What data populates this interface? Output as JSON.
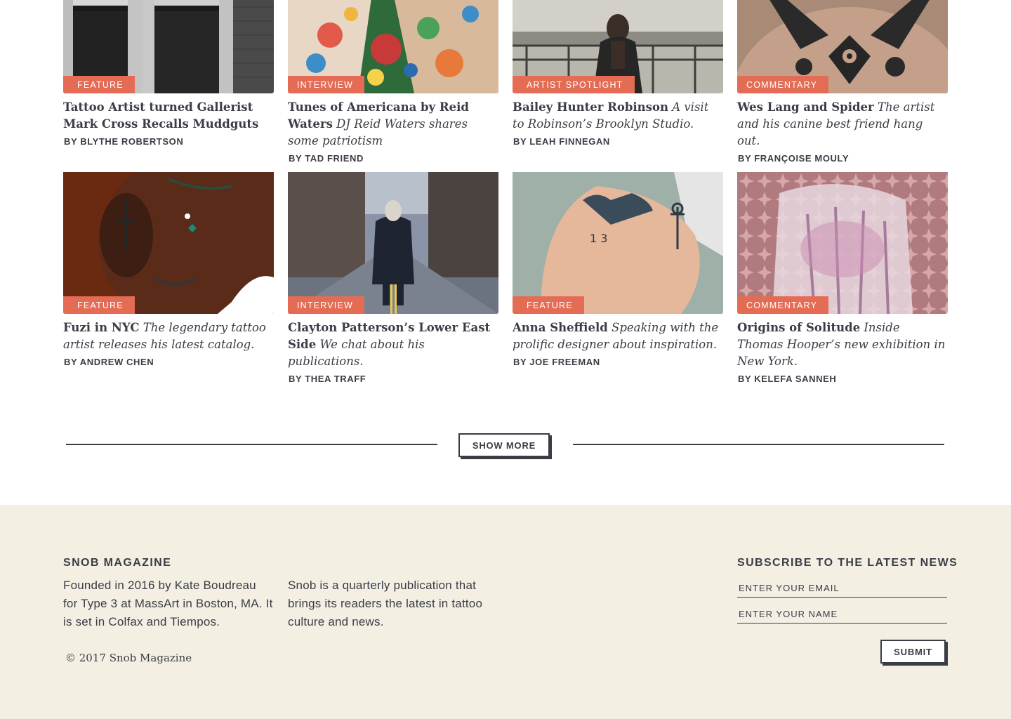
{
  "articles_row1": [
    {
      "category": "Feature",
      "title": "Tattoo Artist turned Gallerist Mark Cross Recalls Muddguts",
      "dek": "",
      "byline": "BY BLYTHE ROBERTSON"
    },
    {
      "category": "Interview",
      "title": "Tunes of Americana by Reid Waters",
      "dek": "DJ Reid Waters shares some patriotism",
      "byline": "BY TAD FRIEND"
    },
    {
      "category": "Artist Spotlight",
      "title": "Bailey Hunter Robinson",
      "dek": "A visit to Robinson’s Brooklyn Studio.",
      "byline": "BY LEAH FINNEGAN"
    },
    {
      "category": "Commentary",
      "title": "Wes Lang and Spider",
      "dek": "The artist and his canine best friend hang out.",
      "byline": "BY FRANÇOISE MOULY"
    }
  ],
  "articles_row2": [
    {
      "category": "Feature",
      "title": "Fuzi in NYC",
      "dek": "The legendary tattoo artist releases his latest catalog.",
      "byline": "BY ANDREW CHEN"
    },
    {
      "category": "Interview",
      "title": "Clayton Patterson’s Lower East Side",
      "dek": "We chat about his publications.",
      "byline": "BY THEA TRAFF"
    },
    {
      "category": "Feature",
      "title": "Anna Sheffield",
      "dek": "Speaking with the prolific designer about inspiration.",
      "byline": "BY JOE FREEMAN"
    },
    {
      "category": "Commentary",
      "title": "Origins of Solitude",
      "dek": " Inside Thomas Hooper’s new exhibition in New York.",
      "byline": "BY KELEFA SANNEH"
    }
  ],
  "show_more_label": "SHOW MORE",
  "footer": {
    "title": "SNOB MAGAZINE",
    "about_1": "Founded in 2016 by Kate Boudreau for Type 3 at MassArt in Boston, MA. It is set in Colfax and Tiempos.",
    "about_2": "Snob is a quarterly publication that brings its readers the latest in tattoo culture and news.",
    "copyright": "© 2017 Snob Magazine",
    "subscribe_title": "SUBSCRIBE TO THE LATEST NEWS",
    "email_placeholder": "ENTER YOUR EMAIL",
    "name_placeholder": "ENTER YOUR NAME",
    "submit_label": "SUBMIT"
  },
  "colors": {
    "accent": "#e56c54",
    "text": "#3a3d46",
    "footer_bg": "#f3efe3"
  }
}
